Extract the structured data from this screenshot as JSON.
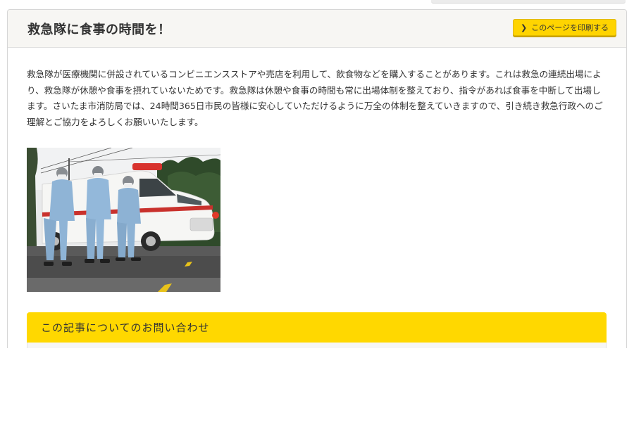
{
  "article": {
    "title": "救急隊に食事の時間を！",
    "print_button_label": "このページを印刷する",
    "paragraph": "救急隊が医療機関に併設されているコンビニエンスストアや売店を利用して、飲食物などを購入することがあります。これは救急の連続出場により、救急隊が休憩や食事を摂れていないためです。救急隊は休憩や食事の時間も常に出場体制を整えており、指令があれば食事を中断して出場します。さいたま市消防局では、24時間365日市民の皆様に安心していただけるように万全の体制を整えていきますので、引き続き救急行政へのご理解とご協力をよろしくお願いいたします。"
  },
  "contact": {
    "heading": "この記事についてのお問い合わせ"
  },
  "colors": {
    "accent_yellow": "#ffd800",
    "header_bg": "#f7f6f3",
    "text": "#333333"
  },
  "icons": {
    "print_chevron": "chevron-right-icon"
  }
}
